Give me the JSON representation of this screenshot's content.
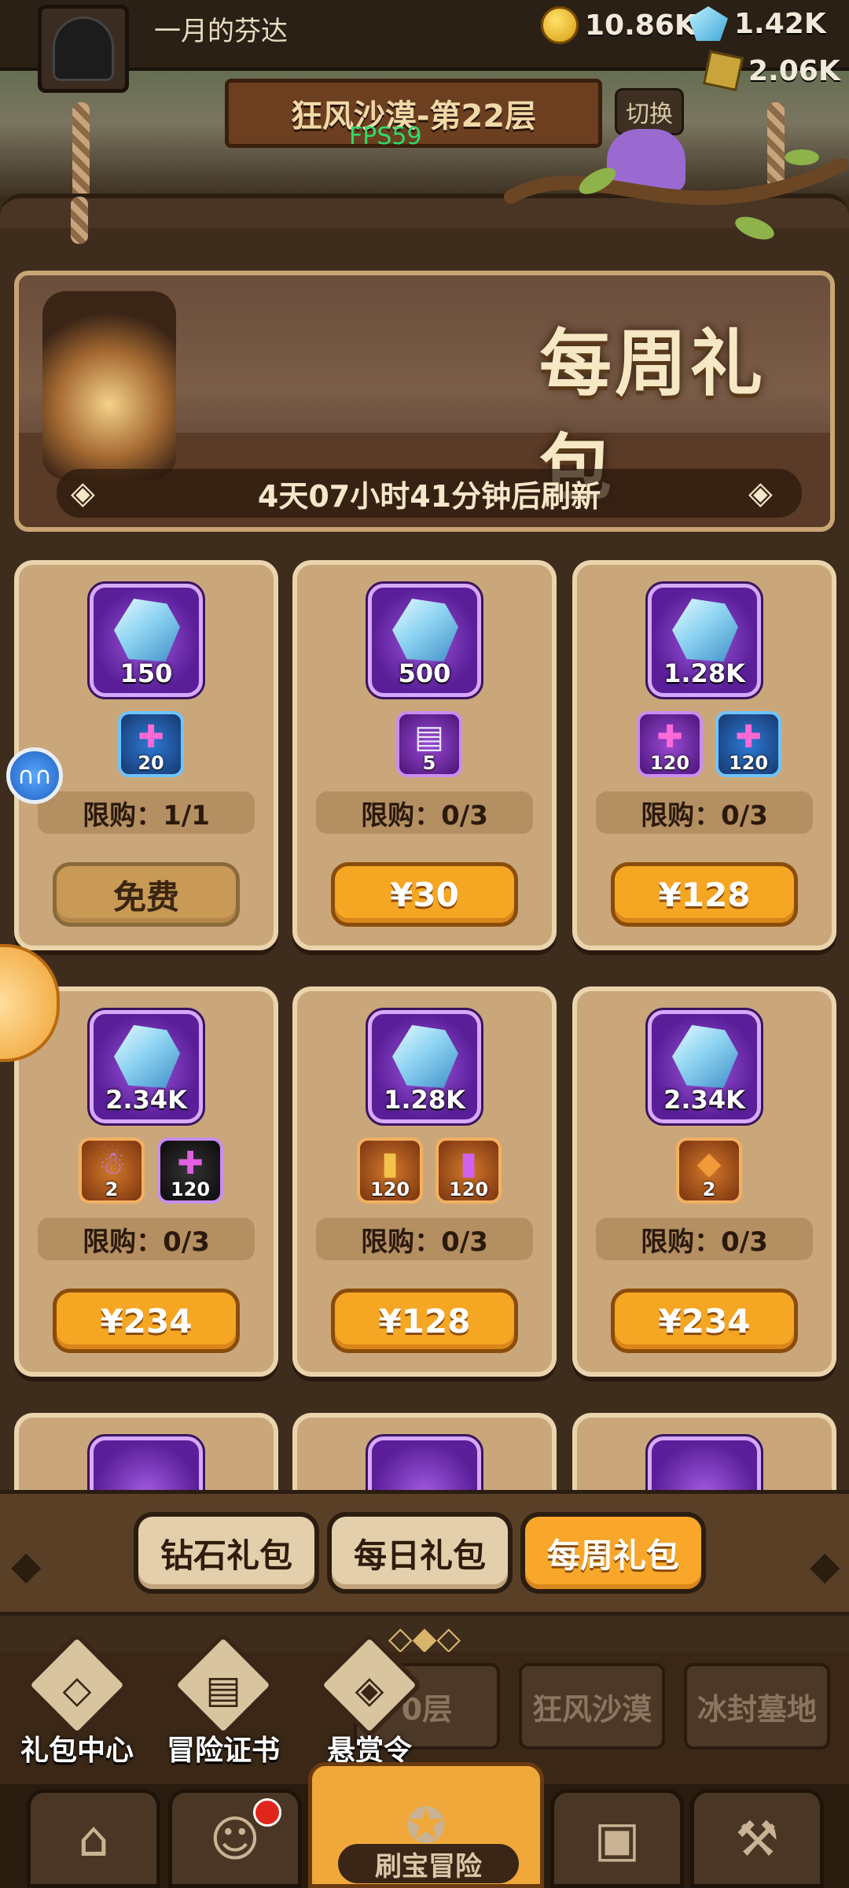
{
  "header": {
    "player_name": "一月的芬达",
    "coins": "10.86K",
    "gems": "1.42K",
    "gold": "2.06K",
    "floor_title": "狂风沙漠-第22层",
    "fps": "FPS59",
    "switch_label": "切换"
  },
  "banner": {
    "title": "每周礼包",
    "refresh_text": "4天07小时41分钟后刷新"
  },
  "packs": [
    {
      "gem_amount": "150",
      "items": [
        {
          "icon": "puzzle-icon",
          "count": "20",
          "style": "blue"
        }
      ],
      "limit": "限购：1/1",
      "price": "免费",
      "free": true
    },
    {
      "gem_amount": "500",
      "items": [
        {
          "icon": "scroll-icon",
          "count": "5",
          "style": "purple"
        }
      ],
      "limit": "限购：0/3",
      "price": "¥30",
      "free": false
    },
    {
      "gem_amount": "1.28K",
      "items": [
        {
          "icon": "puzzle-icon",
          "count": "120",
          "style": "purple"
        },
        {
          "icon": "puzzle-icon",
          "count": "120",
          "style": "blue"
        }
      ],
      "limit": "限购：0/3",
      "price": "¥128",
      "free": false
    },
    {
      "gem_amount": "2.34K",
      "items": [
        {
          "icon": "doll-icon",
          "count": "2",
          "style": "orange"
        },
        {
          "icon": "shadow-puzzle-icon",
          "count": "120",
          "style": "dark"
        }
      ],
      "limit": "限购：0/3",
      "price": "¥234",
      "free": false
    },
    {
      "gem_amount": "1.28K",
      "items": [
        {
          "icon": "gold-card-icon",
          "count": "120",
          "style": "orange"
        },
        {
          "icon": "purple-card-icon",
          "count": "120",
          "style": "orange"
        }
      ],
      "limit": "限购：0/3",
      "price": "¥128",
      "free": false
    },
    {
      "gem_amount": "2.34K",
      "items": [
        {
          "icon": "chest-shard-icon",
          "count": "2",
          "style": "orange"
        }
      ],
      "limit": "限购：0/3",
      "price": "¥234",
      "free": false
    }
  ],
  "tabs": [
    {
      "label": "钻石礼包",
      "active": false
    },
    {
      "label": "每日礼包",
      "active": false
    },
    {
      "label": "每周礼包",
      "active": true
    }
  ],
  "map_tiles": [
    "0层",
    "狂风沙漠",
    "冰封墓地"
  ],
  "quick_actions": [
    {
      "label": "礼包中心",
      "icon": "diamond-icon"
    },
    {
      "label": "冒险证书",
      "icon": "book-icon"
    },
    {
      "label": "悬赏令",
      "icon": "bounty-icon"
    }
  ],
  "bottom_nav": {
    "center_label": "刷宝冒险"
  },
  "colors": {
    "accent_orange": "#f5a623",
    "panel_brown": "#caa77a",
    "gem_purple": "#5a1e98"
  }
}
